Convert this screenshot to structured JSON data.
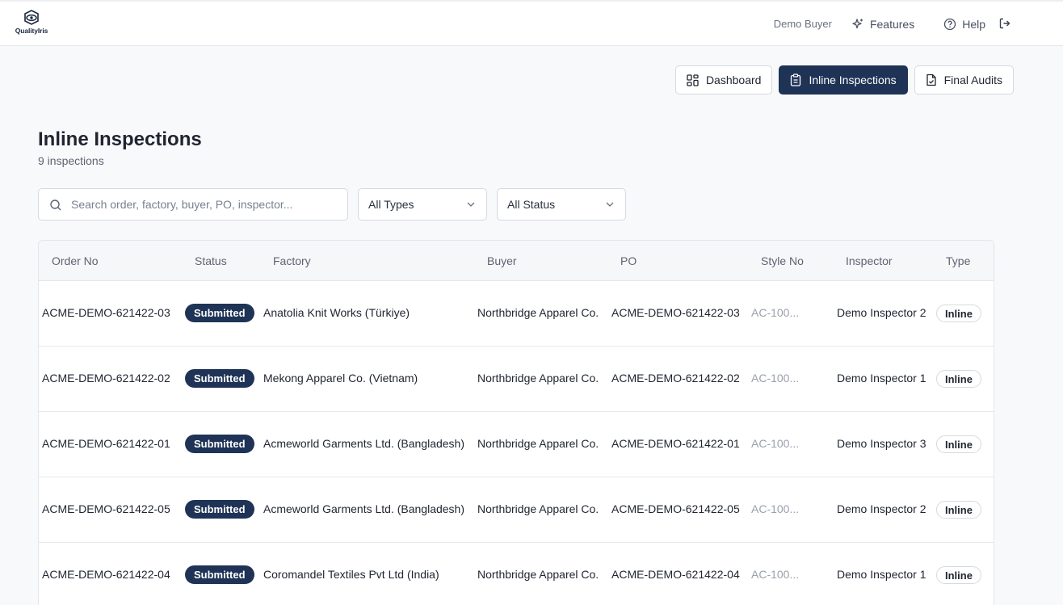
{
  "app": {
    "logo_text": "QualityIris"
  },
  "header": {
    "user_name": "Demo Buyer",
    "features_label": "Features",
    "help_label": "Help",
    "logout_icon": "logout-icon"
  },
  "view_switch": {
    "dashboard_label": "Dashboard",
    "inline_label": "Inline Inspections",
    "final_label": "Final Audits",
    "active": "Inline Inspections"
  },
  "page": {
    "title": "Inline Inspections",
    "count": "9 inspections"
  },
  "filters": {
    "search_placeholder": "Search order, factory, buyer, PO, inspector...",
    "type_value": "All Types",
    "status_value": "All Status"
  },
  "table": {
    "columns": [
      "Order No",
      "Status",
      "Factory",
      "Buyer",
      "PO",
      "Style No",
      "Inspector",
      "Type"
    ],
    "rows": [
      {
        "order": "ACME-DEMO-621422-03",
        "status": "Submitted",
        "factory": "Anatolia Knit Works (Türkiye)",
        "buyer": "Northbridge Apparel Co.",
        "po": "ACME-DEMO-621422-03",
        "style": "AC-100...",
        "inspector": "Demo Inspector 2",
        "type": "Inline"
      },
      {
        "order": "ACME-DEMO-621422-02",
        "status": "Submitted",
        "factory": "Mekong Apparel Co. (Vietnam)",
        "buyer": "Northbridge Apparel Co.",
        "po": "ACME-DEMO-621422-02",
        "style": "AC-100...",
        "inspector": "Demo Inspector 1",
        "type": "Inline"
      },
      {
        "order": "ACME-DEMO-621422-01",
        "status": "Submitted",
        "factory": "Acmeworld Garments Ltd. (Bangladesh)",
        "buyer": "Northbridge Apparel Co.",
        "po": "ACME-DEMO-621422-01",
        "style": "AC-100...",
        "inspector": "Demo Inspector 3",
        "type": "Inline"
      },
      {
        "order": "ACME-DEMO-621422-05",
        "status": "Submitted",
        "factory": "Acmeworld Garments Ltd. (Bangladesh)",
        "buyer": "Northbridge Apparel Co.",
        "po": "ACME-DEMO-621422-05",
        "style": "AC-100...",
        "inspector": "Demo Inspector 2",
        "type": "Inline"
      },
      {
        "order": "ACME-DEMO-621422-04",
        "status": "Submitted",
        "factory": "Coromandel Textiles Pvt Ltd (India)",
        "buyer": "Northbridge Apparel Co.",
        "po": "ACME-DEMO-621422-04",
        "style": "AC-100...",
        "inspector": "Demo Inspector 1",
        "type": "Inline"
      }
    ]
  },
  "colors": {
    "primary": "#1e3356",
    "background": "#f8f9fb",
    "border": "#d6d9e0"
  }
}
